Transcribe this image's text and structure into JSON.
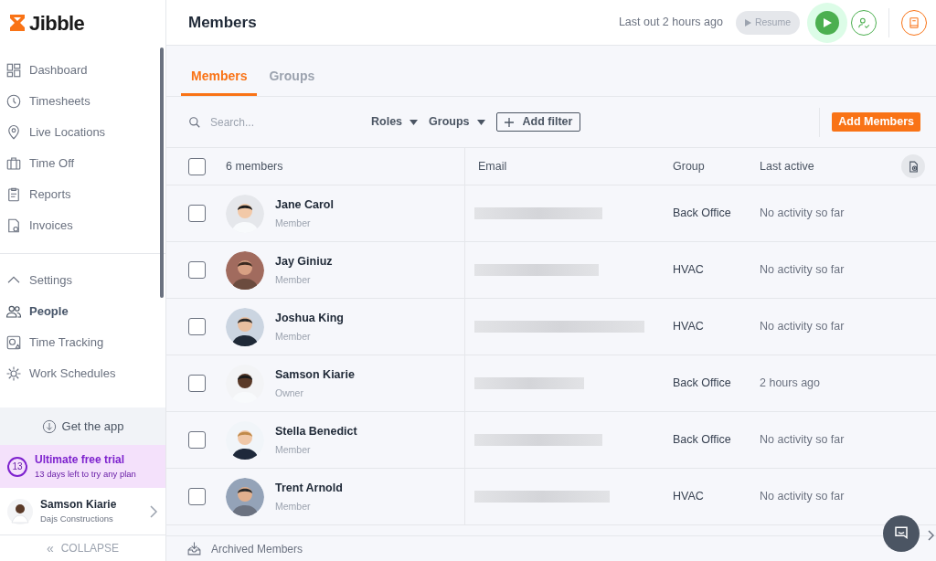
{
  "brand": "Jibble",
  "nav": [
    {
      "label": "Dashboard",
      "selected": false
    },
    {
      "label": "Timesheets",
      "selected": false
    },
    {
      "label": "Live Locations",
      "selected": false
    },
    {
      "label": "Time Off",
      "selected": false
    },
    {
      "label": "Reports",
      "selected": false
    },
    {
      "label": "Invoices",
      "selected": false
    }
  ],
  "settings": {
    "label": "Settings",
    "expanded": true,
    "children": [
      {
        "label": "People",
        "selected": true
      },
      {
        "label": "Time Tracking",
        "selected": false
      },
      {
        "label": "Work Schedules",
        "selected": false
      }
    ]
  },
  "get_app": "Get the app",
  "trial": {
    "days": "13",
    "title": "Ultimate free trial",
    "subtitle": "13 days left to try any plan"
  },
  "user": {
    "name": "Samson Kiarie",
    "company": "Dajs Constructions"
  },
  "collapse_icon": "«",
  "collapse": "COLLAPSE",
  "header": {
    "title": "Members",
    "status": "Last out 2 hours ago",
    "resume": "Resume"
  },
  "tabs": [
    {
      "label": "Members",
      "selected": true
    },
    {
      "label": "Groups",
      "selected": false
    }
  ],
  "toolbar": {
    "search_placeholder": "Search...",
    "filters": [
      "Roles",
      "Groups"
    ],
    "add_filter": "Add filter",
    "add_members": "Add Members"
  },
  "table": {
    "all_checked": false,
    "count": "6 members",
    "columns": [
      "Email",
      "Group",
      "Last active"
    ],
    "rows": [
      {
        "name": "Jane Carol",
        "role": "Member",
        "group": "Back Office",
        "last_active": "No activity so far",
        "checked": false
      },
      {
        "name": "Jay Giniuz",
        "role": "Member",
        "group": "HVAC",
        "last_active": "No activity so far",
        "checked": false
      },
      {
        "name": "Joshua King",
        "role": "Member",
        "group": "HVAC",
        "last_active": "No activity so far",
        "checked": false
      },
      {
        "name": "Samson Kiarie",
        "role": "Owner",
        "group": "Back Office",
        "last_active": "2 hours ago",
        "checked": false
      },
      {
        "name": "Stella Benedict",
        "role": "Member",
        "group": "Back Office",
        "last_active": "No activity so far",
        "checked": false
      },
      {
        "name": "Trent Arnold",
        "role": "Member",
        "group": "HVAC",
        "last_active": "No activity so far",
        "checked": false
      }
    ]
  },
  "archived": "Archived Members"
}
